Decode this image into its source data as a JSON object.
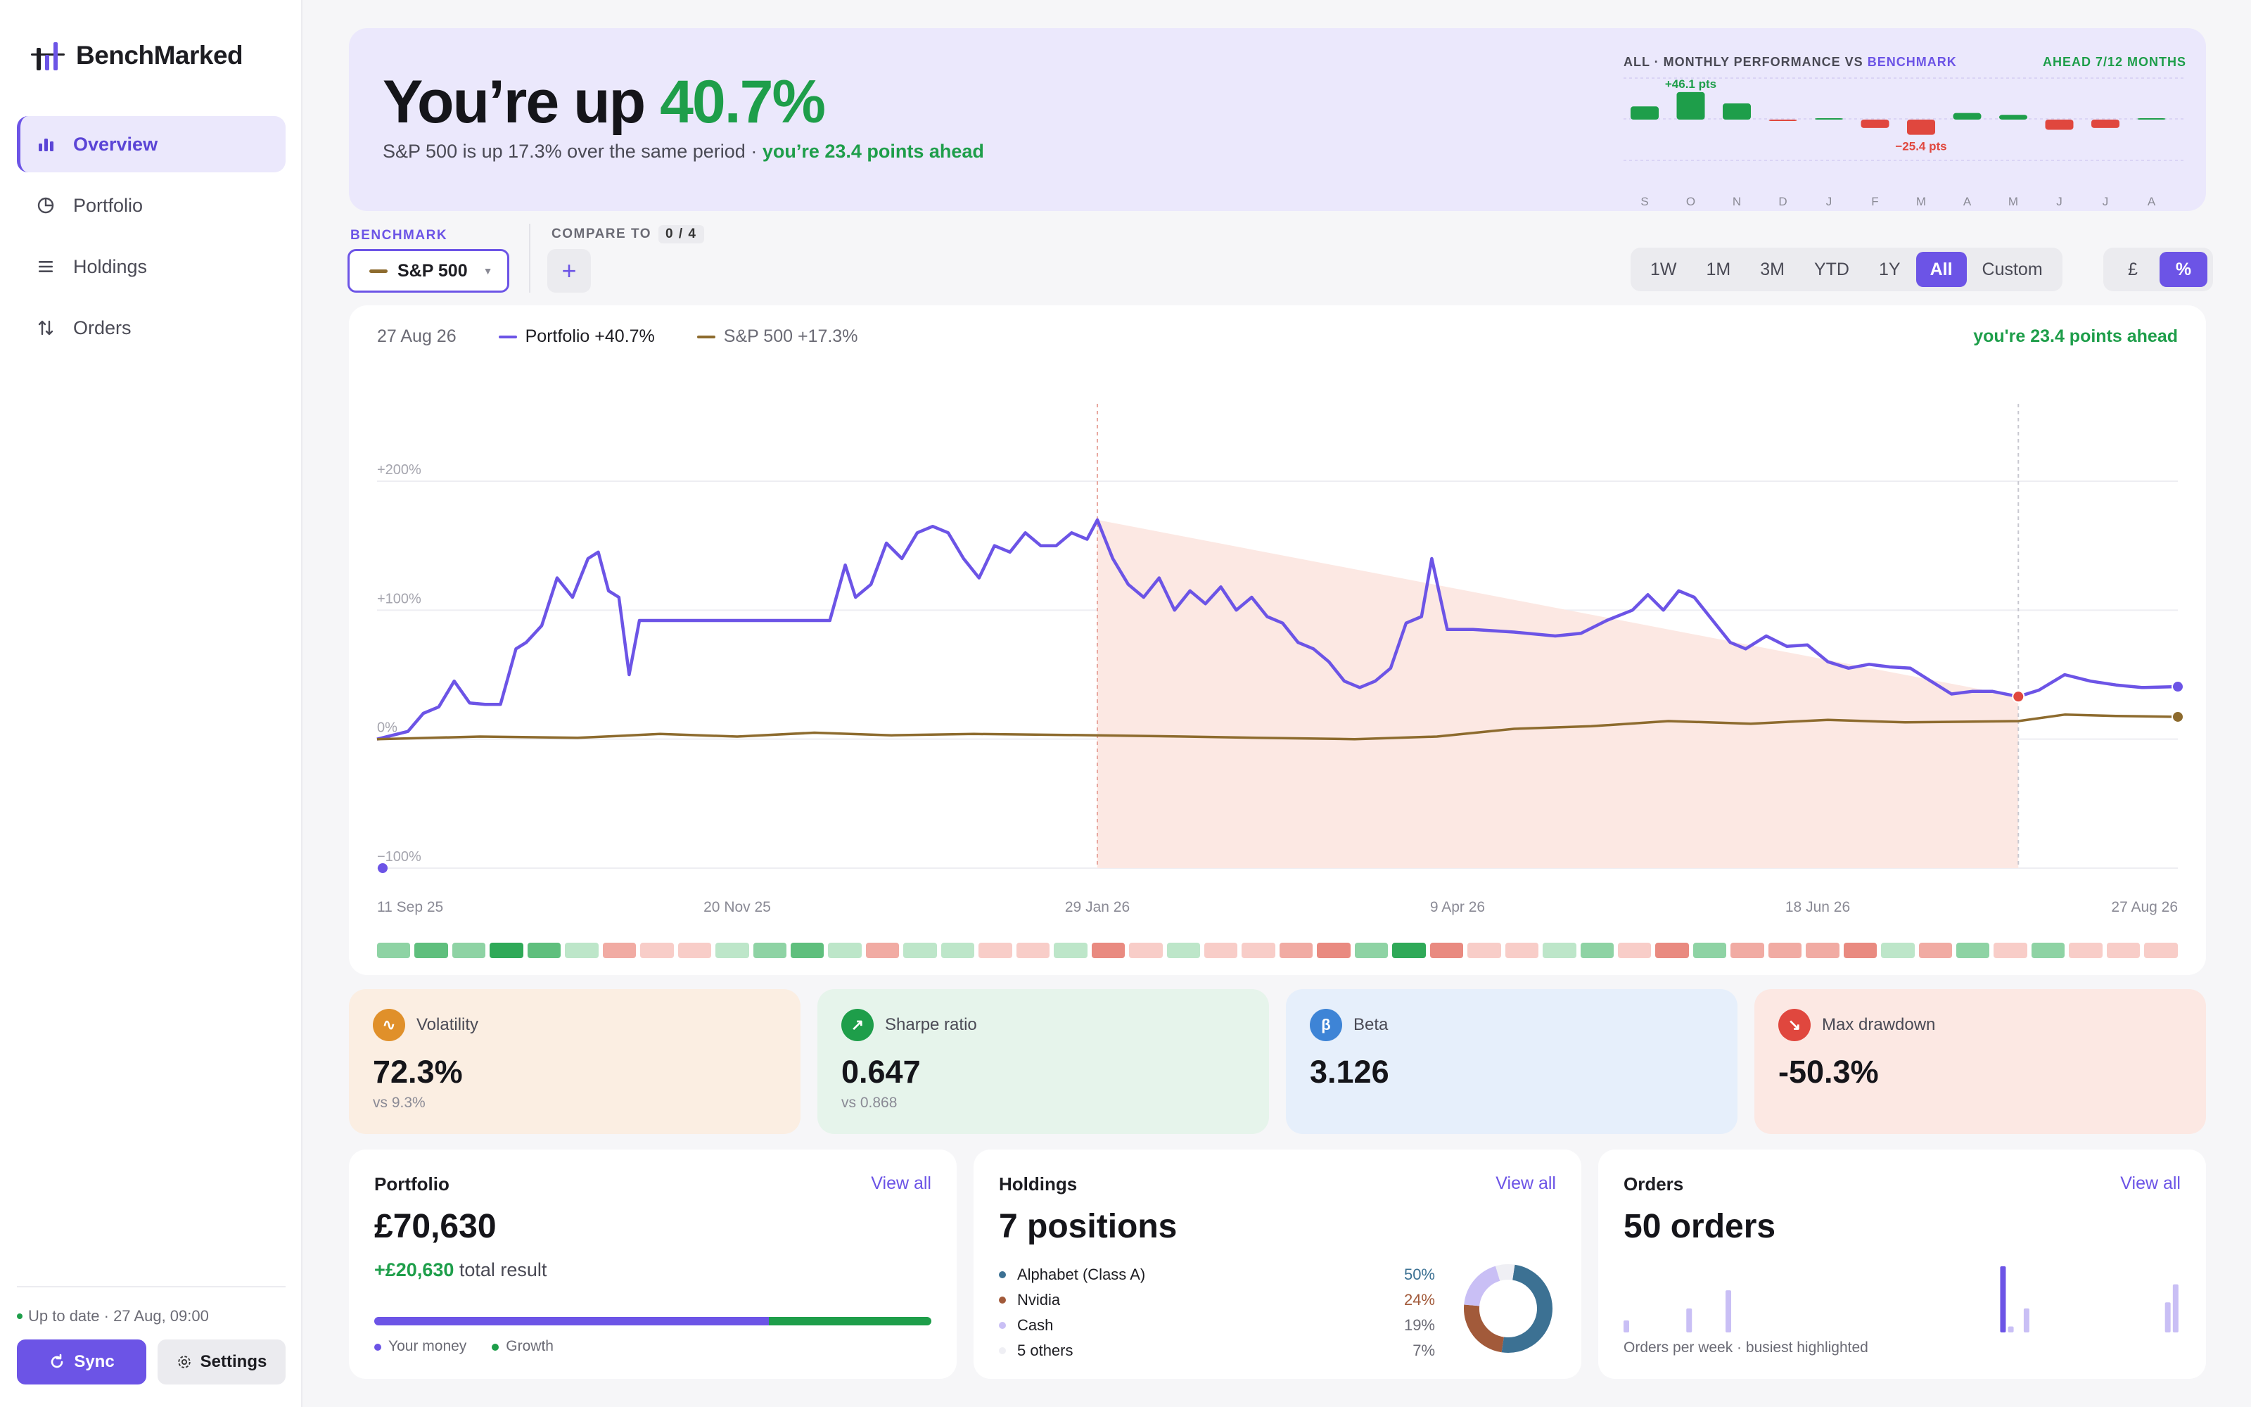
{
  "brand": {
    "name": "BenchMarked"
  },
  "nav": [
    {
      "label": "Overview",
      "icon": "bar-chart-icon",
      "active": true
    },
    {
      "label": "Portfolio",
      "icon": "pie-chart-icon",
      "active": false
    },
    {
      "label": "Holdings",
      "icon": "list-icon",
      "active": false
    },
    {
      "label": "Orders",
      "icon": "swap-arrows-icon",
      "active": false
    }
  ],
  "sidebar_footer": {
    "status": "Up to date · 27 Aug, 09:00",
    "sync_label": "Sync",
    "settings_label": "Settings"
  },
  "hero": {
    "title_prefix": "You’re up ",
    "title_pct": "40.7%",
    "subtitle": "S&P 500 is up 17.3% over the same period · ",
    "subtitle_ahead": "you’re 23.4 points ahead"
  },
  "monthly": {
    "title_prefix": "ALL · MONTHLY PERFORMANCE VS ",
    "title_benchmark": "BENCHMARK",
    "ahead_label": "AHEAD 7/12 MONTHS",
    "best_label": "+46.1 pts",
    "worst_label": "−25.4 pts",
    "months": [
      "S",
      "O",
      "N",
      "D",
      "J",
      "F",
      "M",
      "A",
      "M",
      "J",
      "J",
      "A"
    ],
    "values": [
      22,
      46.1,
      27,
      -2,
      2,
      -14,
      -25.4,
      11,
      8,
      -17,
      -14,
      2
    ]
  },
  "controls": {
    "benchmark_label": "BENCHMARK",
    "benchmark_value": "S&P 500",
    "compare_label": "COMPARE TO",
    "compare_count": "0 / 4",
    "ranges": [
      "1W",
      "1M",
      "3M",
      "YTD",
      "1Y",
      "All",
      "Custom"
    ],
    "active_range": "All",
    "units": [
      "£",
      "%"
    ],
    "active_unit": "%"
  },
  "chart_header": {
    "date": "27 Aug 26",
    "portfolio_label": "Portfolio +40.7%",
    "benchmark_label": "S&P 500 +17.3%",
    "ahead": "you're 23.4 points ahead"
  },
  "colors": {
    "accent": "#6c54e6",
    "benchmark": "#8d6b2e",
    "positive": "#1e9e4a",
    "negative": "#e0473e",
    "drawdown": "#fce8e3"
  },
  "chart_data": {
    "type": "line",
    "ylim": [
      -100,
      200
    ],
    "ytick_labels": [
      "+200%",
      "+100%",
      "0%",
      "−100%"
    ],
    "yticks": [
      200,
      100,
      0,
      -100
    ],
    "xtick_labels": [
      "11 Sep 25",
      "20 Nov 25",
      "29 Jan 26",
      "9 Apr 26",
      "18 Jun 26",
      "27 Aug 26"
    ],
    "x_start": "2025-09-11",
    "x_end": "2026-08-27",
    "drawdown": {
      "start": "2026-01-29",
      "end": "2026-07-27",
      "peak": 170,
      "trough": 33
    },
    "series": [
      {
        "name": "Portfolio",
        "color": "#6c54e6",
        "points": [
          [
            "2025-09-11",
            0
          ],
          [
            "2025-09-14",
            3
          ],
          [
            "2025-09-17",
            6
          ],
          [
            "2025-09-20",
            20
          ],
          [
            "2025-09-23",
            25
          ],
          [
            "2025-09-26",
            45
          ],
          [
            "2025-09-29",
            28
          ],
          [
            "2025-10-02",
            27
          ],
          [
            "2025-10-05",
            27
          ],
          [
            "2025-10-08",
            70
          ],
          [
            "2025-10-10",
            75
          ],
          [
            "2025-10-13",
            88
          ],
          [
            "2025-10-16",
            125
          ],
          [
            "2025-10-19",
            110
          ],
          [
            "2025-10-22",
            140
          ],
          [
            "2025-10-24",
            145
          ],
          [
            "2025-10-26",
            115
          ],
          [
            "2025-10-28",
            110
          ],
          [
            "2025-10-30",
            50
          ],
          [
            "2025-11-01",
            92
          ],
          [
            "2025-11-10",
            92
          ],
          [
            "2025-11-20",
            92
          ],
          [
            "2025-11-30",
            92
          ],
          [
            "2025-12-08",
            92
          ],
          [
            "2025-12-11",
            135
          ],
          [
            "2025-12-13",
            110
          ],
          [
            "2025-12-16",
            120
          ],
          [
            "2025-12-19",
            152
          ],
          [
            "2025-12-22",
            140
          ],
          [
            "2025-12-25",
            160
          ],
          [
            "2025-12-28",
            165
          ],
          [
            "2025-12-31",
            160
          ],
          [
            "2026-01-03",
            140
          ],
          [
            "2026-01-06",
            125
          ],
          [
            "2026-01-09",
            150
          ],
          [
            "2026-01-12",
            145
          ],
          [
            "2026-01-15",
            160
          ],
          [
            "2026-01-18",
            150
          ],
          [
            "2026-01-21",
            150
          ],
          [
            "2026-01-24",
            160
          ],
          [
            "2026-01-27",
            155
          ],
          [
            "2026-01-29",
            170
          ],
          [
            "2026-02-01",
            140
          ],
          [
            "2026-02-04",
            120
          ],
          [
            "2026-02-07",
            110
          ],
          [
            "2026-02-10",
            125
          ],
          [
            "2026-02-13",
            100
          ],
          [
            "2026-02-16",
            115
          ],
          [
            "2026-02-19",
            105
          ],
          [
            "2026-02-22",
            118
          ],
          [
            "2026-02-25",
            100
          ],
          [
            "2026-02-28",
            110
          ],
          [
            "2026-03-03",
            95
          ],
          [
            "2026-03-06",
            90
          ],
          [
            "2026-03-09",
            75
          ],
          [
            "2026-03-12",
            70
          ],
          [
            "2026-03-15",
            60
          ],
          [
            "2026-03-18",
            45
          ],
          [
            "2026-03-21",
            40
          ],
          [
            "2026-03-24",
            45
          ],
          [
            "2026-03-27",
            55
          ],
          [
            "2026-03-30",
            90
          ],
          [
            "2026-04-02",
            95
          ],
          [
            "2026-04-04",
            140
          ],
          [
            "2026-04-07",
            85
          ],
          [
            "2026-04-12",
            85
          ],
          [
            "2026-04-20",
            83
          ],
          [
            "2026-04-28",
            80
          ],
          [
            "2026-05-03",
            82
          ],
          [
            "2026-05-08",
            92
          ],
          [
            "2026-05-13",
            100
          ],
          [
            "2026-05-16",
            112
          ],
          [
            "2026-05-19",
            100
          ],
          [
            "2026-05-22",
            115
          ],
          [
            "2026-05-25",
            110
          ],
          [
            "2026-05-28",
            95
          ],
          [
            "2026-06-01",
            75
          ],
          [
            "2026-06-04",
            70
          ],
          [
            "2026-06-08",
            80
          ],
          [
            "2026-06-12",
            72
          ],
          [
            "2026-06-16",
            73
          ],
          [
            "2026-06-20",
            60
          ],
          [
            "2026-06-24",
            55
          ],
          [
            "2026-06-28",
            58
          ],
          [
            "2026-07-02",
            56
          ],
          [
            "2026-07-06",
            55
          ],
          [
            "2026-07-10",
            45
          ],
          [
            "2026-07-14",
            35
          ],
          [
            "2026-07-18",
            37
          ],
          [
            "2026-07-22",
            37
          ],
          [
            "2026-07-27",
            33
          ],
          [
            "2026-07-31",
            38
          ],
          [
            "2026-08-05",
            50
          ],
          [
            "2026-08-10",
            45
          ],
          [
            "2026-08-15",
            42
          ],
          [
            "2026-08-20",
            40
          ],
          [
            "2026-08-27",
            40.7
          ]
        ]
      },
      {
        "name": "S&P 500",
        "color": "#8d6b2e",
        "points": [
          [
            "2025-09-11",
            0
          ],
          [
            "2025-10-01",
            2
          ],
          [
            "2025-10-20",
            1
          ],
          [
            "2025-11-05",
            4
          ],
          [
            "2025-11-20",
            2
          ],
          [
            "2025-12-05",
            5
          ],
          [
            "2025-12-20",
            3
          ],
          [
            "2026-01-05",
            4
          ],
          [
            "2026-01-29",
            3
          ],
          [
            "2026-02-15",
            2
          ],
          [
            "2026-03-01",
            1
          ],
          [
            "2026-03-20",
            0
          ],
          [
            "2026-04-05",
            2
          ],
          [
            "2026-04-20",
            8
          ],
          [
            "2026-05-05",
            10
          ],
          [
            "2026-05-20",
            14
          ],
          [
            "2026-06-05",
            12
          ],
          [
            "2026-06-20",
            15
          ],
          [
            "2026-07-05",
            13
          ],
          [
            "2026-07-27",
            14
          ],
          [
            "2026-08-05",
            19
          ],
          [
            "2026-08-15",
            18
          ],
          [
            "2026-08-27",
            17.3
          ]
        ]
      }
    ]
  },
  "stats": [
    {
      "label": "Volatility",
      "value": "72.3%",
      "compare": "vs 9.3%",
      "icon": "wave-icon",
      "icon_glyph": "∿",
      "bg": "#fbeee2",
      "icon_bg": "#e0902a"
    },
    {
      "label": "Sharpe ratio",
      "value": "0.647",
      "compare": "vs 0.868",
      "icon": "trend-up-icon",
      "icon_glyph": "↗",
      "bg": "#e6f4eb",
      "icon_bg": "#1e9e4a"
    },
    {
      "label": "Beta",
      "value": "3.126",
      "compare": "",
      "icon": "beta-icon",
      "icon_glyph": "β",
      "bg": "#e6effb",
      "icon_bg": "#3e84d6"
    },
    {
      "label": "Max drawdown",
      "value": "-50.3%",
      "compare": "",
      "icon": "trend-down-icon",
      "icon_glyph": "↘",
      "bg": "#fce8e3",
      "icon_bg": "#e0473e"
    }
  ],
  "portfolio_card": {
    "title": "Portfolio",
    "link": "View all",
    "value": "£70,630",
    "gain": "+£20,630",
    "gain_suffix": " total result",
    "money_share": 0.708,
    "legend_money": "Your money",
    "legend_growth": "Growth"
  },
  "holdings_card": {
    "title": "Holdings",
    "link": "View all",
    "value": "7 positions",
    "items": [
      {
        "name": "Alphabet (Class A)",
        "pct": "50%",
        "share": 50,
        "color": "#3c7193"
      },
      {
        "name": "Nvidia",
        "pct": "24%",
        "share": 24,
        "color": "#a25a3a"
      },
      {
        "name": "Cash",
        "pct": "19%",
        "share": 19,
        "color": "#c9bff5"
      },
      {
        "name": "5 others",
        "pct": "7%",
        "share": 7,
        "color": "#efeff4"
      }
    ]
  },
  "orders_card": {
    "title": "Orders",
    "link": "View all",
    "value": "50 orders",
    "caption": "Orders per week · busiest highlighted",
    "weekly": [
      2,
      0,
      0,
      0,
      0,
      0,
      0,
      0,
      4,
      0,
      0,
      0,
      0,
      7,
      0,
      0,
      0,
      0,
      0,
      0,
      0,
      0,
      0,
      0,
      0,
      0,
      0,
      0,
      0,
      0,
      0,
      0,
      0,
      0,
      0,
      0,
      0,
      0,
      0,
      0,
      0,
      0,
      0,
      0,
      0,
      0,
      0,
      0,
      11,
      1,
      0,
      4,
      0,
      0,
      0,
      0,
      0,
      0,
      0,
      0,
      0,
      0,
      0,
      0,
      0,
      0,
      0,
      0,
      0,
      5,
      8
    ],
    "busiest_index": 48
  },
  "heat": [
    2,
    3,
    2,
    4,
    3,
    1,
    -2,
    -1,
    -1,
    1,
    2,
    3,
    1,
    -2,
    1,
    1,
    -1,
    -1,
    1,
    -3,
    -1,
    1,
    -1,
    -1,
    -2,
    -3,
    2,
    4,
    -3,
    -1,
    -1,
    1,
    2,
    -1,
    -3,
    2,
    -2,
    -2,
    -2,
    -3,
    1,
    -2,
    2,
    -1,
    2,
    -1,
    -1,
    -1
  ]
}
